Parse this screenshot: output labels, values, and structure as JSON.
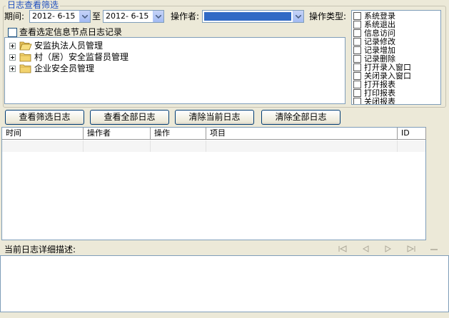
{
  "filter": {
    "group_title": "日志查看筛选",
    "period_label": "期间:",
    "date_from": "2012- 6-15",
    "to_label": "至",
    "date_to": "2012- 6-15",
    "operator_label": "操作者:",
    "operator_value": "",
    "optype_label": "操作类型:",
    "node_log_checkbox_label": "查看选定信息节点日志记录"
  },
  "tree": {
    "items": [
      {
        "label": "安监执法人员管理",
        "icon": "folder-open-icon"
      },
      {
        "label": "村（居）安全监督员管理",
        "icon": "folder-icon"
      },
      {
        "label": "企业安全员管理",
        "icon": "folder-icon"
      }
    ]
  },
  "op_types": [
    "系统登录",
    "系统退出",
    "信息访问",
    "记录修改",
    "记录增加",
    "记录删除",
    "打开录入窗口",
    "关闭录入窗口",
    "打开报表",
    "打印报表",
    "关闭报表"
  ],
  "buttons": {
    "view_filtered": "查看筛选日志",
    "view_all": "查看全部日志",
    "clear_current": "清除当前日志",
    "clear_all": "清除全部日志"
  },
  "grid": {
    "columns": [
      "时间",
      "操作者",
      "操作",
      "项目",
      "ID"
    ]
  },
  "detail": {
    "label": "当前日志详细描述:",
    "nav_icons": [
      "first-record-icon",
      "prev-record-icon",
      "next-record-icon",
      "last-record-icon",
      "delete-record-icon"
    ]
  },
  "colors": {
    "group_title": "#1f4fbf",
    "selection": "#316ac5",
    "background": "#ece9d8"
  }
}
